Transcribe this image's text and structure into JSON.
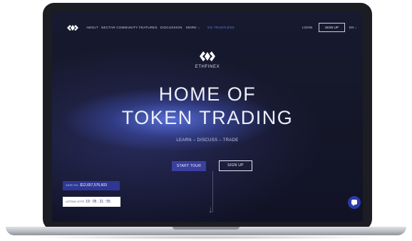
{
  "nav": {
    "items": [
      "ABOUT",
      "NECTAR COMMUNITY",
      "FEATURES",
      "DISCUSSION",
      "MORE",
      "GO TRUSTLESS"
    ],
    "more_chevron": "⌵",
    "login": "LOGIN",
    "signup": "SIGN UP",
    "language": "EN",
    "language_chevron": "⌵"
  },
  "hero": {
    "brand": "ETHFINEX",
    "headline_line1": "HOME OF",
    "headline_line2": "TOKEN TRADING",
    "tagline": "LEARN – DISCUSS – TRADE",
    "start_tour": "START TOUR",
    "signup": "SIGN UP",
    "down_arrow": "↓"
  },
  "stats": {
    "volume_label": "24HR VOL",
    "volume_value": "$12,657,576,603",
    "vote_label": "LISTING VOTE",
    "vote_value": "19 : 05 : 21 : 55"
  },
  "colors": {
    "accent": "#3a3fa0",
    "background": "#151729",
    "highlight": "#6f7dd6"
  },
  "icons": {
    "logo": "ethfinex-logo-icon",
    "chat": "chat-icon",
    "chevron": "chevron-down-icon",
    "arrow": "arrow-down-icon"
  }
}
